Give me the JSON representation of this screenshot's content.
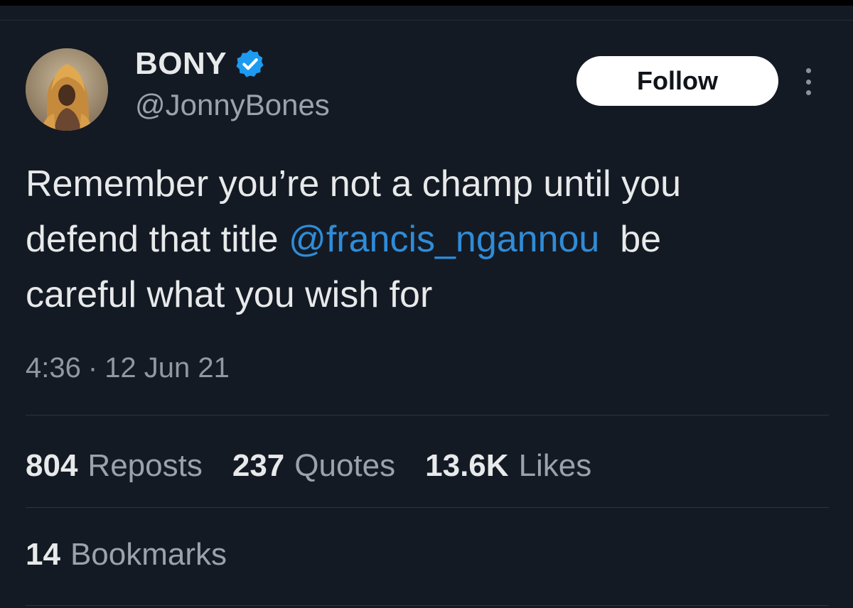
{
  "author": {
    "display_name": "BONY",
    "handle": "@JonnyBones",
    "verified_icon": "verified-badge-icon",
    "avatar": "lion-headdress-photo"
  },
  "actions": {
    "follow_label": "Follow",
    "more_icon": "more-vertical-icon"
  },
  "tweet": {
    "line1": "Remember you’re not a champ until you",
    "line2_before": "defend that title ",
    "mention": "@francis_ngannou",
    "line2_after": "  be",
    "line3": "careful what you wish for"
  },
  "meta": {
    "time": "4:36",
    "separator": "·",
    "date": "12 Jun 21"
  },
  "stats": {
    "reposts_count": "804",
    "reposts_label": "Reposts",
    "quotes_count": "237",
    "quotes_label": "Quotes",
    "likes_count": "13.6K",
    "likes_label": "Likes",
    "bookmarks_count": "14",
    "bookmarks_label": "Bookmarks"
  },
  "colors": {
    "background": "#141a23",
    "text": "#e7e9ea",
    "muted": "#9aa3ad",
    "link": "#2f8cd8",
    "verified": "#1d9bf0"
  }
}
